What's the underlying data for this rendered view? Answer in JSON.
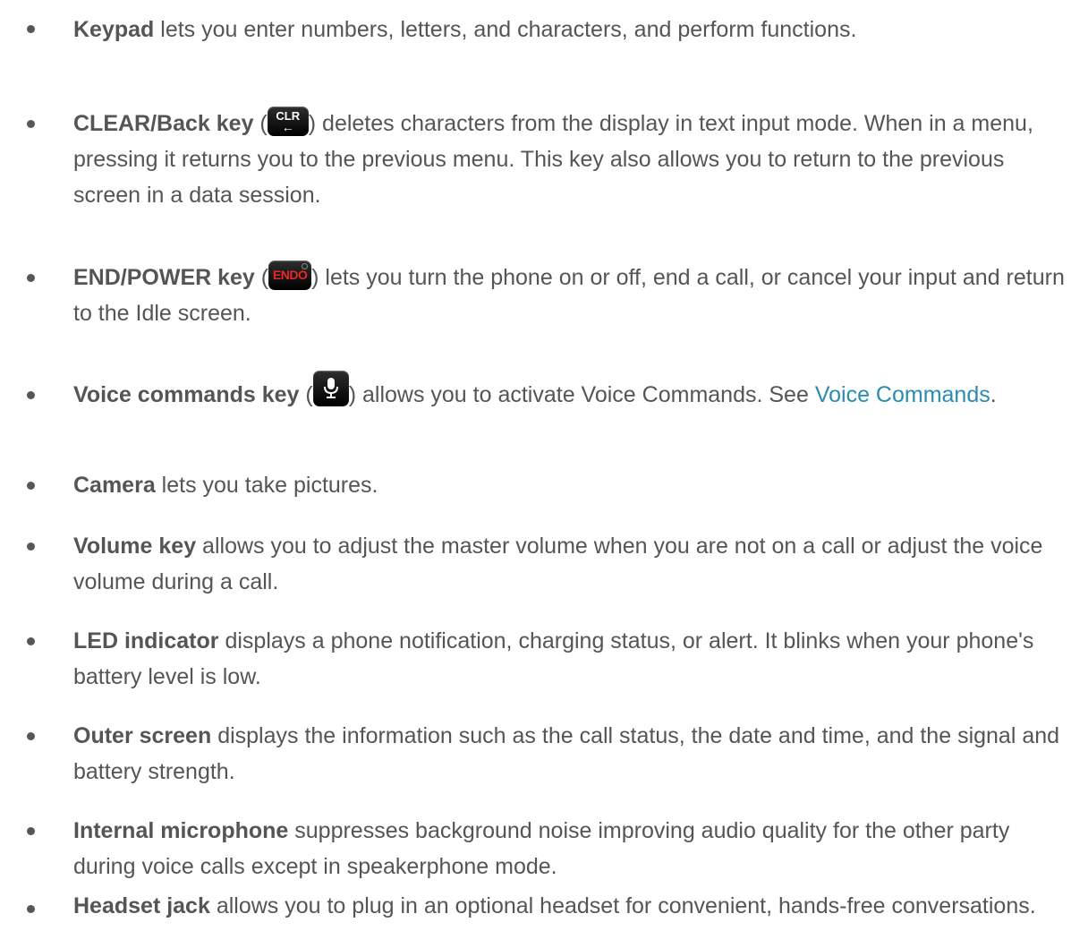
{
  "items": [
    {
      "term": "Keypad",
      "text": " lets you enter numbers, letters, and characters, and perform functions."
    },
    {
      "term": "CLEAR/Back key",
      "open": " (",
      "icon": "clr-key-icon",
      "icon_label": "CLR",
      "close": ") deletes characters from the display in text input mode. When in a menu, pressing it returns you to the previous menu. This key also allows you to return to the previous screen in a data session."
    },
    {
      "term": "END/POWER key",
      "open": " (",
      "icon": "end-power-key-icon",
      "icon_label": "ENDO",
      "close": ") lets you turn the phone on or off, end a call, or cancel your input and return to the Idle screen."
    },
    {
      "term": "Voice commands key",
      "open": " (",
      "icon": "voice-commands-key-icon",
      "close": ") allows you to activate Voice Commands. See ",
      "link": "Voice Commands",
      "after": "."
    },
    {
      "term": "Camera",
      "text": " lets you take pictures."
    },
    {
      "term": "Volume key",
      "text": " allows you to adjust the master volume when you are not on a call or adjust the voice volume during a call."
    },
    {
      "term": "LED indicator",
      "text": " displays a phone notification, charging status, or alert. It blinks when your phone's battery level is low."
    },
    {
      "term": "Outer screen",
      "text": " displays the information such as the call status, the date and time, and the signal and battery strength."
    },
    {
      "term": "Internal microphone",
      "text": " suppresses background noise improving audio quality for the other party during voice calls except in speakerphone mode."
    },
    {
      "term": "Headset jack",
      "text": " allows you to plug in an optional headset for convenient, hands-free conversations."
    }
  ],
  "colors": {
    "text": "#555555",
    "link": "#2a8cae",
    "bullet": "#575757"
  }
}
